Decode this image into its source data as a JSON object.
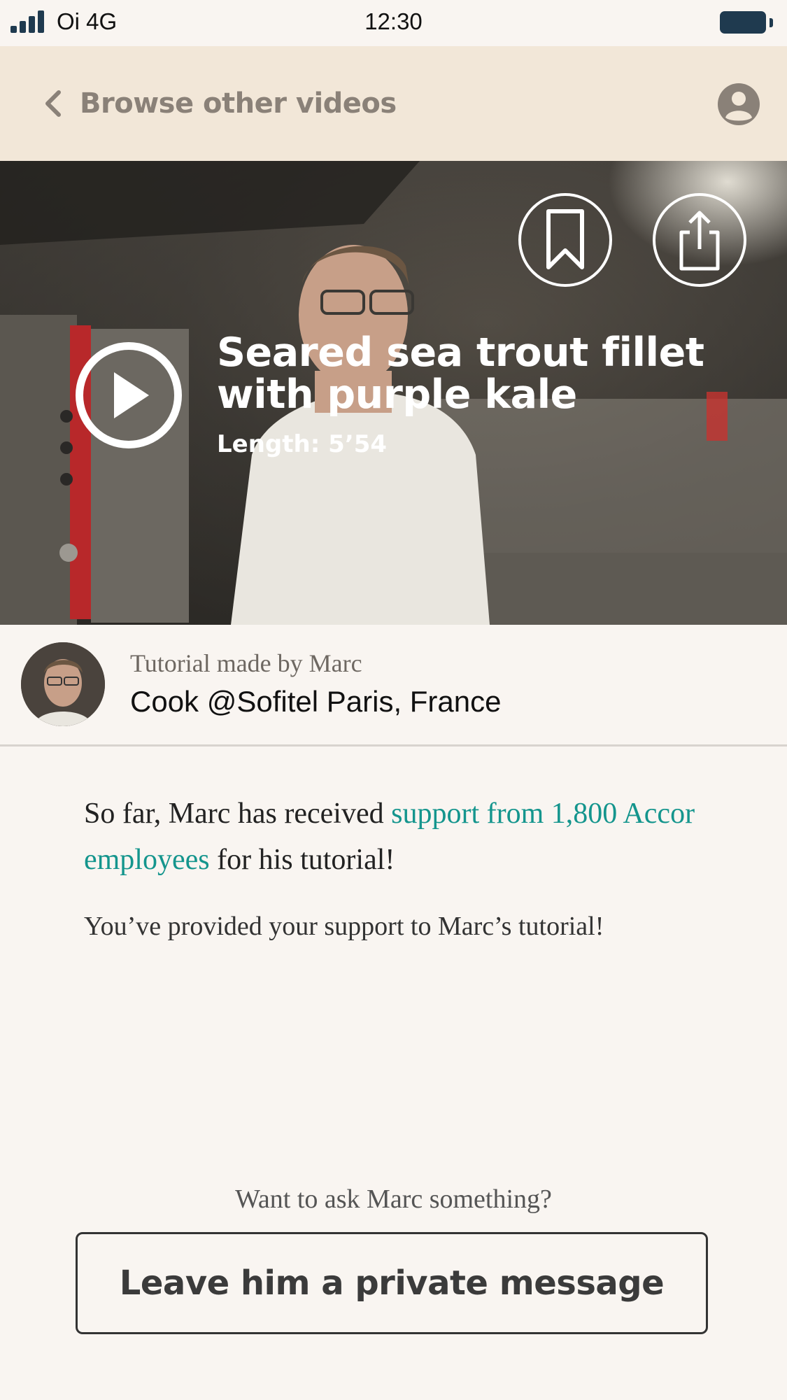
{
  "status_bar": {
    "carrier": "Oi 4G",
    "time": "12:30"
  },
  "nav": {
    "back_label": "Browse other videos",
    "back_icon": "chevron-left-icon",
    "account_icon": "user-circle-icon"
  },
  "video": {
    "title": "Seared sea trout fillet with purple kale",
    "length": "Length: 5’54",
    "bookmark_icon": "bookmark-icon",
    "share_icon": "share-icon",
    "play_icon": "play-icon"
  },
  "author": {
    "subtitle": "Tutorial made by Marc",
    "title": "Cook @Sofitel Paris, France"
  },
  "support": {
    "prefix": "So far, Marc has received ",
    "link": "support from 1,800 Accor employees",
    "suffix": " for his tutorial!",
    "provided": "You’ve provided your support to Marc’s tutorial!"
  },
  "contact": {
    "prompt": "Want to ask Marc something?",
    "button_label": "Leave him a private message"
  },
  "colors": {
    "nav_bg": "#f2e7d8",
    "page_bg": "#f9f5f1",
    "link": "#14958d"
  }
}
